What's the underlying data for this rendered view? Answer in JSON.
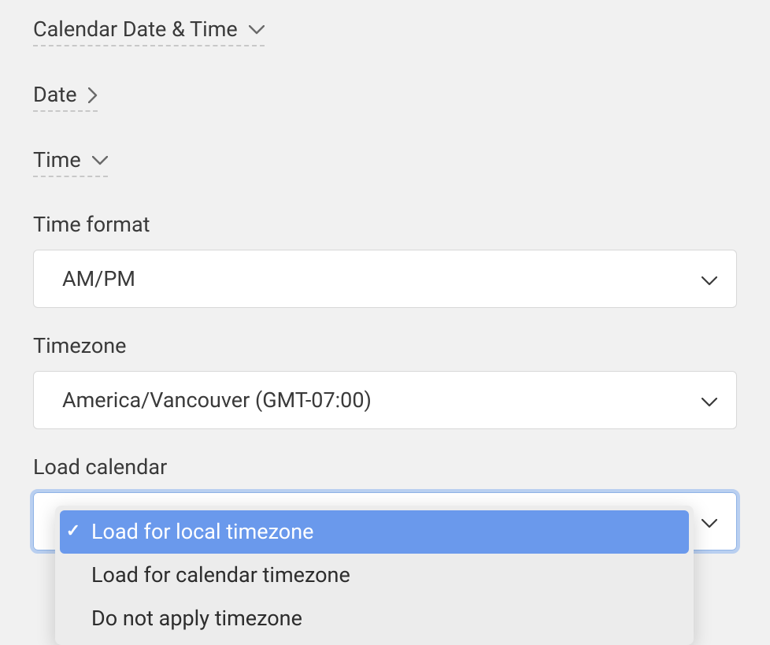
{
  "headings": {
    "calendar_datetime": "Calendar Date & Time",
    "date": "Date",
    "time": "Time"
  },
  "fields": {
    "time_format": {
      "label": "Time format",
      "value": "AM/PM"
    },
    "timezone": {
      "label": "Timezone",
      "value": "America/Vancouver (GMT-07:00)"
    },
    "load_calendar": {
      "label": "Load calendar",
      "options": [
        "Load for local timezone",
        "Load for calendar timezone",
        "Do not apply timezone"
      ],
      "selected_index": 0
    }
  }
}
